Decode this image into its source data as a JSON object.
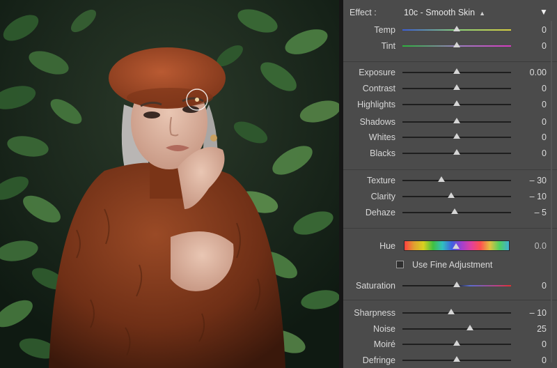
{
  "effect": {
    "label": "Effect :",
    "value": "10c - Smooth Skin"
  },
  "temp_tint": [
    {
      "key": "temp",
      "label": "Temp",
      "value": "0",
      "pos": 0.5,
      "gradient": "linear-gradient(to right,#3b5dd6,#8ad27a,#d8d040)"
    },
    {
      "key": "tint",
      "label": "Tint",
      "value": "0",
      "pos": 0.5,
      "gradient": "linear-gradient(to right,#2cb23c,#9a80c0,#d83ac0)"
    }
  ],
  "tone": [
    {
      "key": "exposure",
      "label": "Exposure",
      "value": "0.00",
      "pos": 0.5
    },
    {
      "key": "contrast",
      "label": "Contrast",
      "value": "0",
      "pos": 0.5
    },
    {
      "key": "highlights",
      "label": "Highlights",
      "value": "0",
      "pos": 0.5
    },
    {
      "key": "shadows",
      "label": "Shadows",
      "value": "0",
      "pos": 0.5
    },
    {
      "key": "whites",
      "label": "Whites",
      "value": "0",
      "pos": 0.5
    },
    {
      "key": "blacks",
      "label": "Blacks",
      "value": "0",
      "pos": 0.5
    }
  ],
  "presence": [
    {
      "key": "texture",
      "label": "Texture",
      "value": "– 30",
      "pos": 0.36
    },
    {
      "key": "clarity",
      "label": "Clarity",
      "value": "– 10",
      "pos": 0.45
    },
    {
      "key": "dehaze",
      "label": "Dehaze",
      "value": "– 5",
      "pos": 0.48
    }
  ],
  "hue": {
    "label": "Hue",
    "value": "0.0",
    "pos": 0.5
  },
  "fine_adjustment": {
    "label": "Use Fine Adjustment",
    "checked": false
  },
  "saturation": [
    {
      "key": "saturation",
      "label": "Saturation",
      "value": "0",
      "pos": 0.5,
      "gradient": "linear-gradient(to right,#1e1e1e 0%,#1e1e1e 50%,#5a6cd0 62%,#c04080 88%,#e03030 100%)"
    }
  ],
  "detail": [
    {
      "key": "sharpness",
      "label": "Sharpness",
      "value": "– 10",
      "pos": 0.45
    },
    {
      "key": "noise",
      "label": "Noise",
      "value": "25",
      "pos": 0.62
    },
    {
      "key": "moire",
      "label": "Moiré",
      "value": "0",
      "pos": 0.5
    },
    {
      "key": "defringe",
      "label": "Defringe",
      "value": "0",
      "pos": 0.5
    }
  ],
  "colors": {
    "panel_bg": "#4b4b4b",
    "track": "#1e1e1e",
    "thumb": "#d6d6d6",
    "text": "#d8d8d8"
  }
}
